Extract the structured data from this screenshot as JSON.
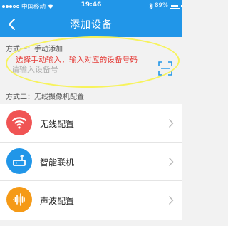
{
  "status_bar": {
    "carrier": "中国移动",
    "time": "19:46",
    "battery": "89%"
  },
  "header": {
    "title": "添加设备"
  },
  "method1": {
    "label": "方式一：手动添加",
    "annotation": "选择手动输入，输入对应的设备号码",
    "input_placeholder": "请输入设备号",
    "input_value": ""
  },
  "method2": {
    "label": "方式二：无线摄像机配置",
    "items": [
      {
        "label": "无线配置",
        "icon": "wifi-icon",
        "color": "#f05454"
      },
      {
        "label": "智能联机",
        "icon": "router-icon",
        "color": "#2196e8"
      },
      {
        "label": "声波配置",
        "icon": "sound-wave-icon",
        "color": "#f59a17"
      }
    ]
  },
  "colors": {
    "accent": "#2196e8",
    "annotation": "#e53935",
    "highlight": "#f7f35c"
  }
}
